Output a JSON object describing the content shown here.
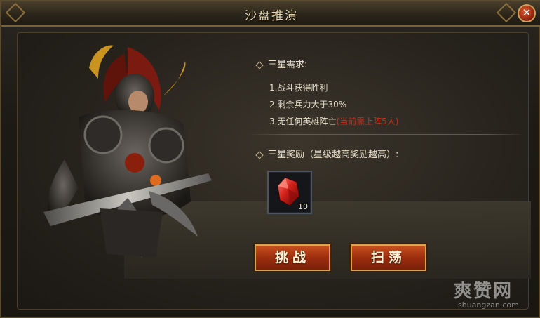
{
  "window": {
    "title": "沙盘推演"
  },
  "requirements": {
    "header": "三星需求:",
    "items": [
      {
        "text": "1.战斗获得胜利",
        "note": ""
      },
      {
        "text": "2.剩余兵力大于30%",
        "note": ""
      },
      {
        "text": "3.无任何英雄阵亡",
        "note": "(当前需上阵5人)"
      }
    ]
  },
  "rewards": {
    "header": "三星奖励（星级越高奖励越高）:",
    "items": [
      {
        "icon": "red-gem-icon",
        "count": "10"
      }
    ]
  },
  "buttons": {
    "challenge": "挑战",
    "sweep": "扫荡"
  },
  "watermark": {
    "logo": "爽赞网",
    "url": "shuangzan.com"
  },
  "colors": {
    "accent": "#c9501e",
    "note_red": "#d02a1a",
    "gold_border": "#d9a54a"
  }
}
